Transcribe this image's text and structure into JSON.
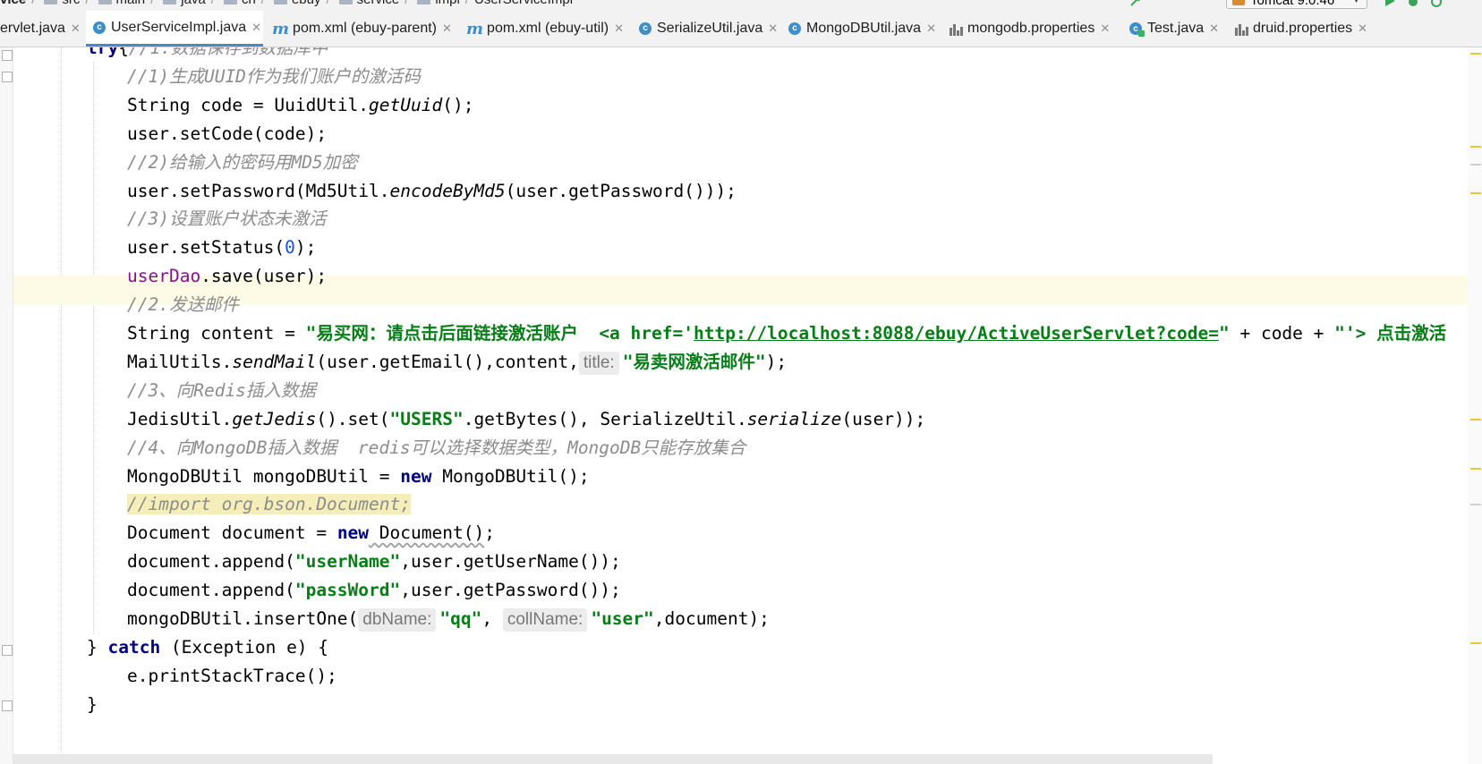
{
  "navbar": {
    "crumbs": [
      {
        "label": "vice",
        "bold": true,
        "folder": false
      },
      {
        "label": "src",
        "bold": false,
        "folder": true
      },
      {
        "label": "main",
        "bold": false,
        "folder": true
      },
      {
        "label": "java",
        "bold": false,
        "folder": true
      },
      {
        "label": "cn",
        "bold": false,
        "folder": true
      },
      {
        "label": "ebuy",
        "bold": false,
        "folder": true
      },
      {
        "label": "service",
        "bold": false,
        "folder": true
      },
      {
        "label": "impl",
        "bold": false,
        "folder": true
      },
      {
        "label": "UserServiceImpl",
        "bold": false,
        "folder": false
      }
    ],
    "run_config": "Tomcat 9.0.46"
  },
  "tabs": [
    {
      "label": "ervlet.java",
      "icon": "none",
      "active": false
    },
    {
      "label": "UserServiceImpl.java",
      "icon": "class",
      "active": true
    },
    {
      "label": "pom.xml (ebuy-parent)",
      "icon": "maven",
      "active": false
    },
    {
      "label": "pom.xml (ebuy-util)",
      "icon": "maven",
      "active": false
    },
    {
      "label": "SerializeUtil.java",
      "icon": "class",
      "active": false
    },
    {
      "label": "MongoDBUtil.java",
      "icon": "class",
      "active": false
    },
    {
      "label": "mongodb.properties",
      "icon": "properties",
      "active": false
    },
    {
      "label": "Test.java",
      "icon": "class-test",
      "active": false
    },
    {
      "label": "druid.properties",
      "icon": "properties",
      "active": false
    }
  ],
  "code": [
    {
      "indent": 1,
      "parts": [
        [
          "kw",
          "try"
        ],
        [
          "",
          "{"
        ],
        [
          "cm",
          "//1.数据保存到数据库中"
        ]
      ]
    },
    {
      "indent": 2,
      "parts": [
        [
          "cm",
          "//1)生成UUID作为我们账户的激活码"
        ]
      ]
    },
    {
      "indent": 2,
      "parts": [
        [
          "",
          "String code = UuidUtil."
        ],
        [
          "sm",
          "getUuid"
        ],
        [
          "",
          "();"
        ]
      ]
    },
    {
      "indent": 2,
      "parts": [
        [
          "",
          "user.setCode(code);"
        ]
      ]
    },
    {
      "indent": 2,
      "parts": [
        [
          "cm",
          "//2)给输入的密码用MD5加密"
        ]
      ]
    },
    {
      "indent": 2,
      "parts": [
        [
          "",
          "user.setPassword(Md5Util."
        ],
        [
          "sm",
          "encodeByMd5"
        ],
        [
          "",
          "(user.getPassword()));"
        ]
      ]
    },
    {
      "indent": 2,
      "parts": [
        [
          "cm",
          "//3)设置账户状态未激活"
        ]
      ]
    },
    {
      "indent": 2,
      "parts": [
        [
          "",
          "user.setStatus("
        ],
        [
          "num",
          "0"
        ],
        [
          "",
          ");"
        ]
      ]
    },
    {
      "indent": 2,
      "parts": [
        [
          "fld",
          "userDao"
        ],
        [
          "",
          ".save(user);"
        ]
      ]
    },
    {
      "indent": 2,
      "parts": [
        [
          "cm",
          "//2.发送邮件"
        ]
      ]
    },
    {
      "indent": 2,
      "parts": [
        [
          "",
          "String content = "
        ],
        [
          "st",
          "\"易买网：请点击后面链接激活账户  <a href='"
        ],
        [
          "st url",
          "http://localhost:8088/ebuy/ActiveUserServlet?code="
        ],
        [
          "st",
          "\""
        ],
        [
          "",
          " + code + "
        ],
        [
          "st",
          "\"'> 点击激活"
        ]
      ]
    },
    {
      "indent": 2,
      "parts": [
        [
          "",
          "MailUtils."
        ],
        [
          "sm",
          "sendMail"
        ],
        [
          "",
          "(user.getEmail(),content,"
        ],
        [
          "hint",
          "title:"
        ],
        [
          "st",
          "\"易卖网激活邮件\""
        ],
        [
          "",
          ");"
        ]
      ]
    },
    {
      "indent": 2,
      "parts": [
        [
          "cm",
          "//3、向Redis插入数据"
        ]
      ]
    },
    {
      "indent": 2,
      "parts": [
        [
          "",
          "JedisUtil."
        ],
        [
          "sm",
          "getJedis"
        ],
        [
          "",
          "().set("
        ],
        [
          "st",
          "\"USERS\""
        ],
        [
          "",
          ".getBytes(), SerializeUtil."
        ],
        [
          "sm",
          "serialize"
        ],
        [
          "",
          "(user));"
        ]
      ]
    },
    {
      "indent": 2,
      "parts": [
        [
          "cm",
          "//4、向MongoDB插入数据  redis可以选择数据类型，MongoDB只能存放集合"
        ]
      ]
    },
    {
      "indent": 2,
      "parts": [
        [
          "",
          "MongoDBUtil mongoDBUtil = "
        ],
        [
          "kw",
          "new"
        ],
        [
          "",
          " MongoDBUtil();"
        ]
      ]
    },
    {
      "indent": 2,
      "parts": [
        [
          "cm hlbg",
          "//import org.bson.Document;"
        ]
      ]
    },
    {
      "indent": 2,
      "parts": [
        [
          "",
          "Document document = "
        ],
        [
          "kw",
          "new"
        ],
        [
          "wavy",
          " Document()"
        ],
        [
          "",
          ";"
        ]
      ]
    },
    {
      "indent": 2,
      "parts": [
        [
          "",
          "document.append("
        ],
        [
          "st",
          "\"userName\""
        ],
        [
          "",
          ",user.getUserName());"
        ]
      ]
    },
    {
      "indent": 2,
      "parts": [
        [
          "",
          "document.append("
        ],
        [
          "st",
          "\"passWord\""
        ],
        [
          "",
          ",user.getPassword());"
        ]
      ]
    },
    {
      "indent": 2,
      "parts": [
        [
          "",
          "mongoDBUtil.insertOne("
        ],
        [
          "hint",
          "dbName:"
        ],
        [
          "st",
          "\"qq\""
        ],
        [
          "",
          ", "
        ],
        [
          "hint",
          "collName:"
        ],
        [
          "st",
          "\"user\""
        ],
        [
          "",
          ",document);"
        ]
      ]
    },
    {
      "indent": 1,
      "parts": [
        [
          "",
          "} "
        ],
        [
          "kw",
          "catch"
        ],
        [
          "",
          " (Exception e) {"
        ]
      ]
    },
    {
      "indent": 2,
      "parts": [
        [
          "",
          "e.printStackTrace();"
        ]
      ]
    },
    {
      "indent": 1,
      "parts": [
        [
          "",
          "}"
        ]
      ]
    }
  ],
  "marker_colors": {
    "warning": "#f0c430",
    "info": "#d0d0d0"
  }
}
